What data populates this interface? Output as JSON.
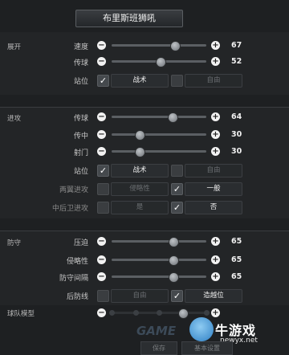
{
  "title": "布里斯班狮吼",
  "sections": {
    "build_up": "展开",
    "attack": "进攻",
    "defence": "防守",
    "team_shape": "球队模型"
  },
  "build_up": {
    "speed": {
      "label": "速度",
      "value": "67",
      "fraction": 0.67
    },
    "passing": {
      "label": "传球",
      "value": "52",
      "fraction": 0.52
    },
    "positioning": {
      "label": "站位",
      "opt1": "战术",
      "opt1_checked": true,
      "opt2": "自由",
      "opt2_checked": false
    }
  },
  "attack": {
    "passing": {
      "label": "传球",
      "value": "64",
      "fraction": 0.64
    },
    "crossing": {
      "label": "传中",
      "value": "30",
      "fraction": 0.3
    },
    "shooting": {
      "label": "射门",
      "value": "30",
      "fraction": 0.3
    },
    "positioning": {
      "label": "站位",
      "opt1": "战术",
      "opt1_checked": true,
      "opt2": "自由",
      "opt2_checked": false
    },
    "wing_attack": {
      "label": "两翼进攻",
      "opt1": "侵略性",
      "opt1_checked": false,
      "opt2": "一般",
      "opt2_checked": true
    },
    "fullback_attack": {
      "label": "中后卫进攻",
      "opt1": "是",
      "opt1_checked": false,
      "opt2": "否",
      "opt2_checked": true
    }
  },
  "defence": {
    "pressure": {
      "label": "压迫",
      "value": "65",
      "fraction": 0.65
    },
    "aggression": {
      "label": "侵略性",
      "value": "65",
      "fraction": 0.65
    },
    "width": {
      "label": "防守间隔",
      "value": "65",
      "fraction": 0.65
    },
    "line": {
      "label": "后防线",
      "opt1": "自由",
      "opt1_checked": false,
      "opt2": "造越位",
      "opt2_checked": true
    }
  },
  "team_shape_stepper": {
    "steps": 5,
    "selected_index": 3
  },
  "footer": {
    "save_label": "保存",
    "reset_label": "基本设置"
  },
  "watermark": {
    "cn": "牛游戏",
    "url": "newyx.net",
    "left": "GAME"
  },
  "colors": {
    "background": "#1e2022",
    "panel": "#232527",
    "accent": "#f2f2f2"
  }
}
